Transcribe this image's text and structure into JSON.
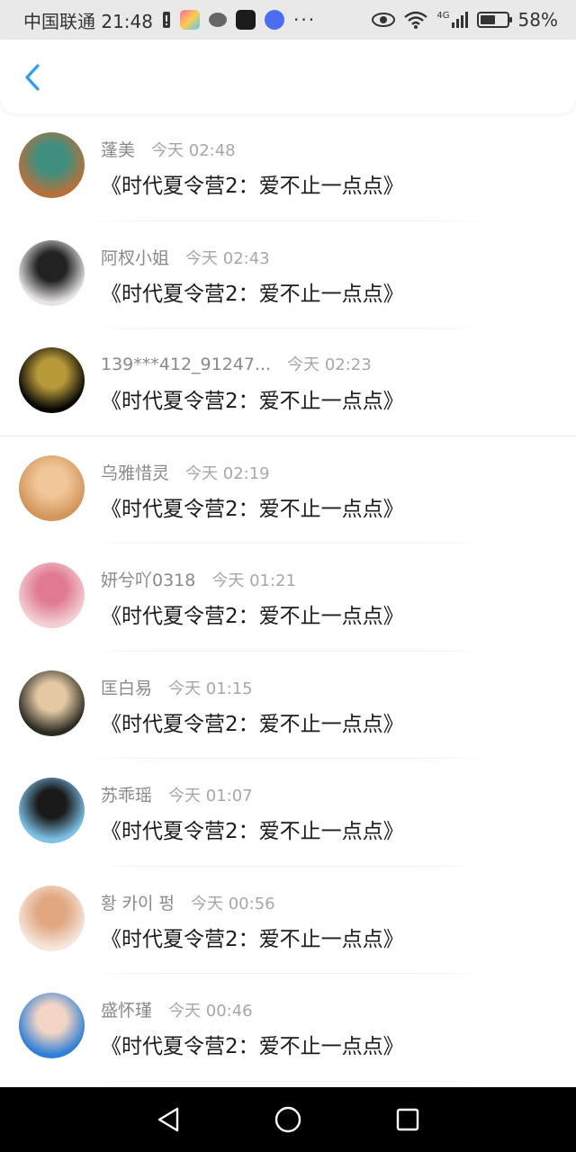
{
  "status_bar": {
    "carrier_time": "中国联通 21:48",
    "dots": "···",
    "network": "4G",
    "battery_text": "58%",
    "battery_level": 0.58
  },
  "nav": {
    "back_icon": "chevron-left-icon",
    "accent": "#2a9df4"
  },
  "messages": [
    {
      "name": "蓬美",
      "time": "今天 02:48",
      "text": "《时代夏令营2：爱不止一点点》",
      "avatar_colors": [
        "#b8703a",
        "#3f8f80"
      ]
    },
    {
      "name": "阿杈小姐",
      "time": "今天 02:43",
      "text": "《时代夏令营2：爱不止一点点》",
      "avatar_colors": [
        "#e8e4e6",
        "#222222"
      ]
    },
    {
      "name": "139***412_91247...",
      "time": "今天 02:23",
      "text": "《时代夏令营2：爱不止一点点》",
      "avatar_colors": [
        "#050505",
        "#b89a3a"
      ]
    },
    {
      "name": "乌雅惜灵",
      "time": "今天 02:19",
      "text": "《时代夏令营2：爱不止一点点》",
      "avatar_colors": [
        "#d2955a",
        "#f2c79a"
      ]
    },
    {
      "name": "妍兮吖0318",
      "time": "今天 01:21",
      "text": "《时代夏令营2：爱不止一点点》",
      "avatar_colors": [
        "#f3cfd4",
        "#e07a90"
      ]
    },
    {
      "name": "匡白易",
      "time": "今天 01:15",
      "text": "《时代夏令营2：爱不止一点点》",
      "avatar_colors": [
        "#2b2a22",
        "#e3c8a2"
      ]
    },
    {
      "name": "苏乖瑶",
      "time": "今天 01:07",
      "text": "《时代夏令营2：爱不止一点点》",
      "avatar_colors": [
        "#7ec2ea",
        "#1a1a1a"
      ]
    },
    {
      "name": "황 카이 펑",
      "time": "今天 00:56",
      "text": "《时代夏令营2：爱不止一点点》",
      "avatar_colors": [
        "#f6e6dc",
        "#e0a780"
      ]
    },
    {
      "name": "盛怀瑾",
      "time": "今天 00:46",
      "text": "《时代夏令营2：爱不止一点点》",
      "avatar_colors": [
        "#2f7fd6",
        "#f2d5c4"
      ]
    }
  ],
  "system_nav": {
    "back": "triangle-back-icon",
    "home": "circle-home-icon",
    "recents": "square-recents-icon"
  }
}
